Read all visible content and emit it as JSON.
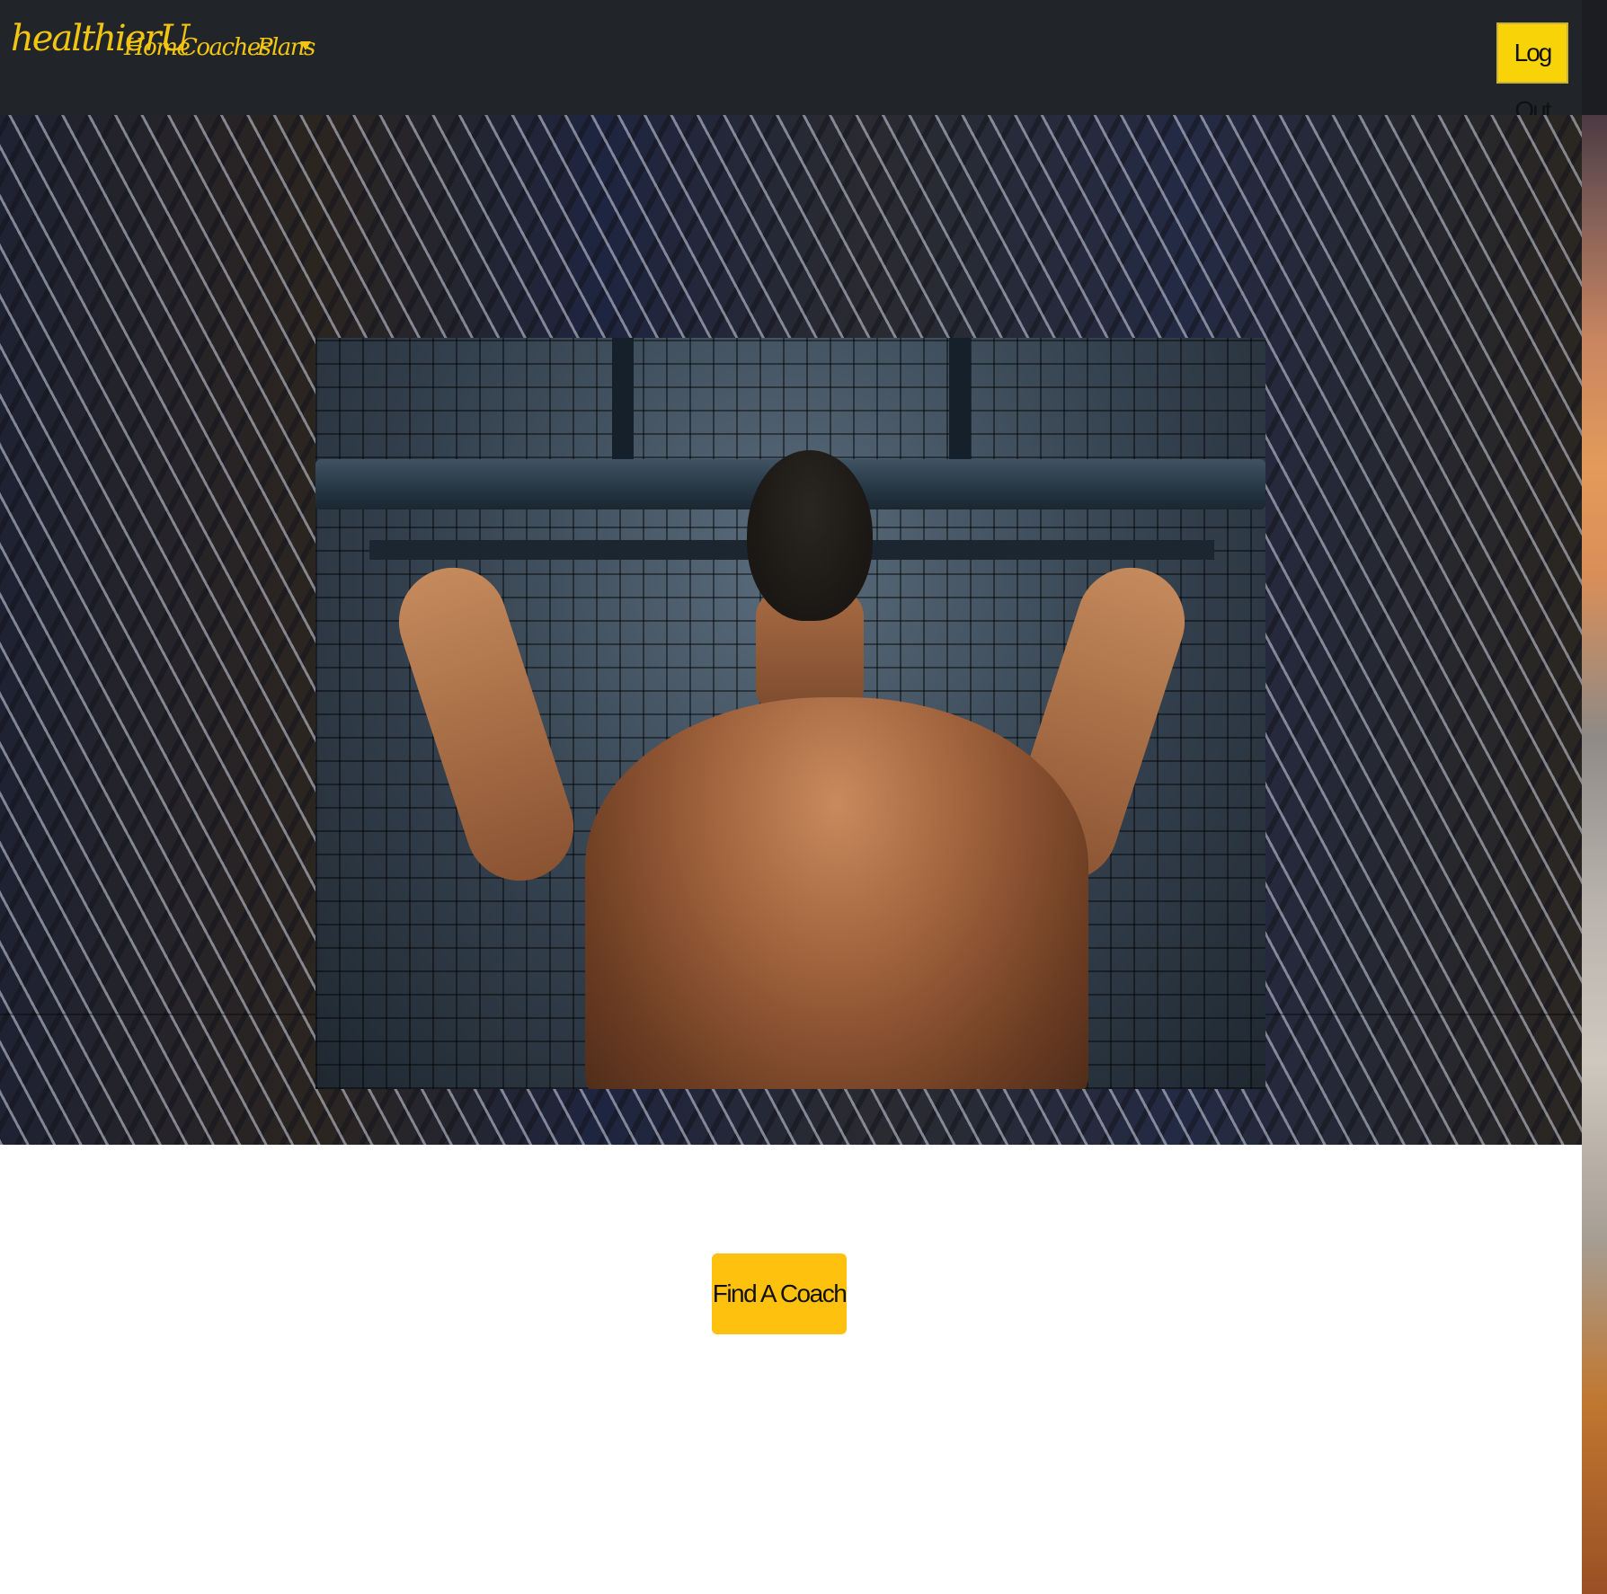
{
  "brand": {
    "name": "healthierU"
  },
  "nav": {
    "items": [
      {
        "label": "Home"
      },
      {
        "label": "Coaches"
      },
      {
        "label": "Plans",
        "has_dropdown": true
      }
    ],
    "logout_label": "Log Out"
  },
  "hero": {
    "image_subject": "man doing pull-ups seen from behind",
    "background": "diamond plate steel texture"
  },
  "cta": {
    "label": "Find A Coach"
  },
  "colors": {
    "navbar_bg": "#212529",
    "brand_yellow": "#f2c511",
    "logout_bg": "#f7d308",
    "cta_bg": "#fec10e",
    "page_bg": "#ffffff"
  }
}
